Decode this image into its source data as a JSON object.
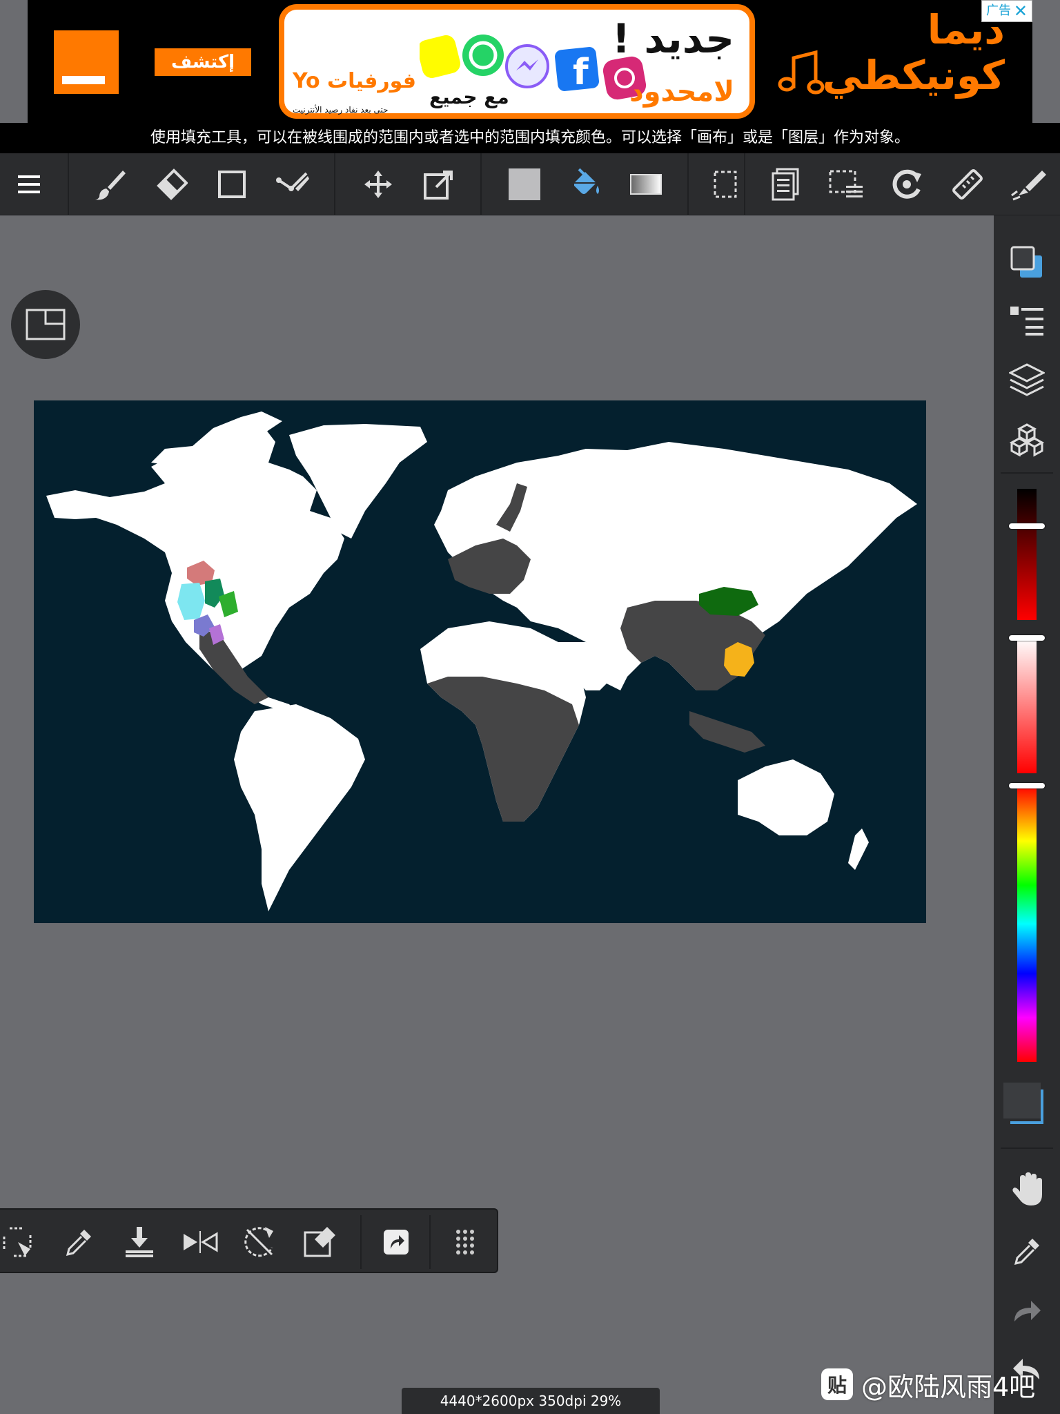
{
  "ad": {
    "cta": "إكتشف",
    "card_title": "جديد !",
    "card_line1": "لامحدود",
    "card_line2": "فورفيات Yo",
    "card_line3": "مع جميع",
    "card_small": "حتى بعد نفاد رصيد الأنترنيت",
    "headline_line1": "ديما",
    "headline_line2": "كونيكطي",
    "badge": "广告",
    "close_glyph": "✕",
    "brand_color": "#ff7900"
  },
  "tip": "使用填充工具，可以在被线围成的范围内或者选中的范围内填充颜色。可以选择「画布」或是「图层」作为对象。",
  "toolbar": {
    "items": [
      "menu-icon",
      "brush-icon",
      "eraser-icon",
      "rectangle-icon",
      "correction-pen-icon",
      "move-icon",
      "transform-icon",
      "fill-color-swatch",
      "fill-bucket-icon",
      "gradient-icon",
      "select-rect-icon",
      "copy-layer-icon",
      "select-menu-icon",
      "rotate-icon",
      "ruler-icon",
      "snap-pen-icon"
    ],
    "active_color": "#5aa9e6"
  },
  "right_panel": {
    "items": [
      "color-swap-icon",
      "layer-list-icon",
      "layers-icon",
      "materials-icon",
      "hand-icon",
      "eyedropper-icon",
      "redo-icon",
      "undo-icon"
    ],
    "foreground_color": "#3b3d40",
    "background_color": "#4aa0de"
  },
  "map": {
    "ocean_color": "#04202e",
    "land_color": "#ffffff",
    "grey_region_color": "#454546",
    "highlight_colors": [
      "#d47a7a",
      "#7de6f0",
      "#128a5a",
      "#2eae2e",
      "#7a7ad0",
      "#b472d6",
      "#0f6a0f",
      "#f5b21a"
    ]
  },
  "bottom_toolbar": {
    "items": [
      "transform-selection-icon",
      "eyedropper-icon",
      "import-icon",
      "flip-icon",
      "rotate-off-icon",
      "clear-icon",
      "share-icon",
      "grip-icon"
    ]
  },
  "status": "4440*2600px 350dpi 29%",
  "watermark": {
    "icon": "贴",
    "text": "@欧陆风雨4吧"
  }
}
